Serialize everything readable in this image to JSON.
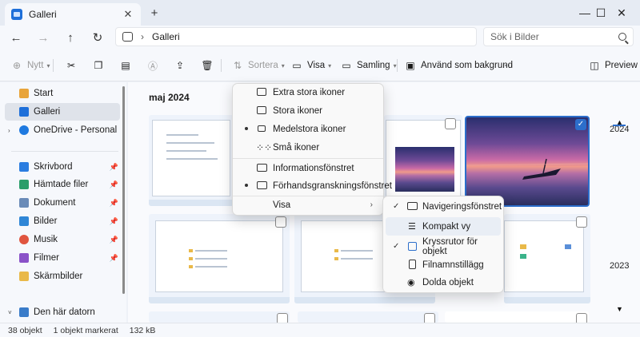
{
  "window": {
    "tab_title": "Galleri",
    "tab_close": "✕",
    "new_tab": "+",
    "minimize": "—",
    "maximize": "☐",
    "close": "✕"
  },
  "nav": {
    "back": "←",
    "forward": "→",
    "up": "↑",
    "refresh": "↻"
  },
  "address": {
    "separator": "›",
    "location": "Galleri"
  },
  "search": {
    "placeholder": "Sök i Bilder"
  },
  "toolbar": {
    "new_label": "Nytt",
    "sort_label": "Sortera",
    "view_label": "Visa",
    "collection_label": "Samling",
    "background_label": "Använd som bakgrund",
    "more_label": "···",
    "preview_label": "Preview"
  },
  "sidebar": {
    "items": [
      {
        "label": "Start"
      },
      {
        "label": "Galleri"
      },
      {
        "label": "OneDrive - Personal"
      },
      {
        "label": "Skrivbord"
      },
      {
        "label": "Hämtade filer"
      },
      {
        "label": "Dokument"
      },
      {
        "label": "Bilder"
      },
      {
        "label": "Musik"
      },
      {
        "label": "Filmer"
      },
      {
        "label": "Skärmbilder"
      },
      {
        "label": "Den här datorn"
      }
    ]
  },
  "gallery": {
    "month": "maj 2024"
  },
  "timeline": {
    "year_top": "2024",
    "year_mid": "2023",
    "up": "▲",
    "down": "▼"
  },
  "view_menu": {
    "items": [
      {
        "label": "Extra stora ikoner"
      },
      {
        "label": "Stora ikoner"
      },
      {
        "label": "Medelstora ikoner",
        "selected": true
      },
      {
        "label": "Små ikoner"
      },
      {
        "label": "Informationsfönstret"
      },
      {
        "label": "Förhandsgranskningsfönstret",
        "selected": true
      },
      {
        "label": "Visa"
      }
    ]
  },
  "show_submenu": {
    "items": [
      {
        "label": "Navigeringsfönstret",
        "checked": true
      },
      {
        "label": "Kompakt vy",
        "hovered": true
      },
      {
        "label": "Kryssrutor för objekt",
        "checked": true
      },
      {
        "label": "Filnamnstillägg"
      },
      {
        "label": "Dolda objekt"
      }
    ]
  },
  "status": {
    "count": "38 objekt",
    "selected": "1 objekt markerat",
    "size": "132 kB"
  },
  "colors": {
    "accent": "#2c6ecb",
    "folder": "#e9b949",
    "onedrive": "#1f7ae0"
  },
  "icons": [
    "home-icon",
    "gallery-icon",
    "cloud-icon",
    "desktop-icon",
    "download-icon",
    "document-icon",
    "pictures-icon",
    "music-icon",
    "video-icon",
    "folder-icon",
    "computer-icon",
    "pin-icon",
    "cut-icon",
    "copy-icon",
    "paste-icon",
    "rename-icon",
    "share-icon",
    "delete-icon",
    "sort-icon",
    "view-icon",
    "collection-icon",
    "wallpaper-icon",
    "preview-icon",
    "search-icon"
  ]
}
